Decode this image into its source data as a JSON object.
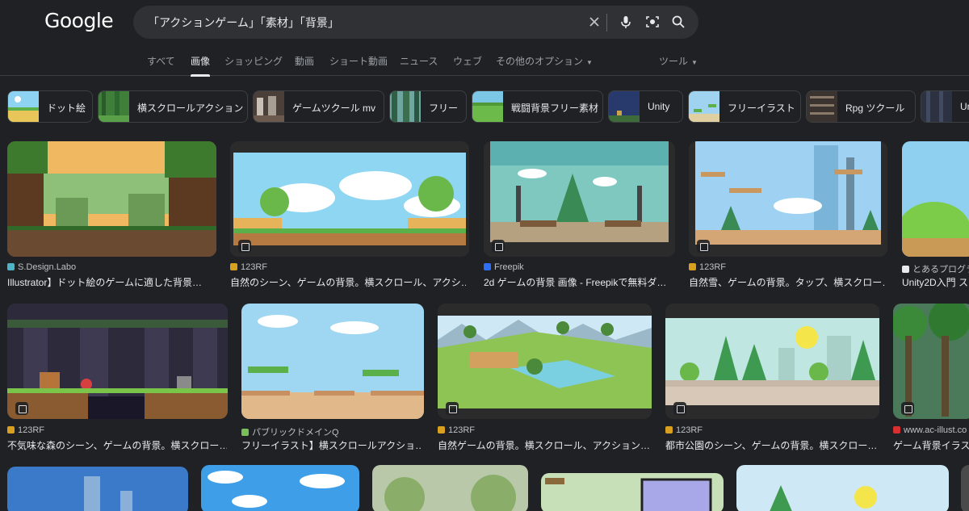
{
  "logo": "Google",
  "search": {
    "query": "「アクションゲーム」「素材」「背景」"
  },
  "icons": {
    "clear": "close-icon",
    "voice": "mic-icon",
    "lens": "camera-lens-icon",
    "search": "search-icon"
  },
  "tabs": [
    {
      "label": "すべて"
    },
    {
      "label": "画像"
    },
    {
      "label": "ショッピング"
    },
    {
      "label": "動画"
    },
    {
      "label": "ショート動画"
    },
    {
      "label": "ニュース"
    },
    {
      "label": "ウェブ"
    },
    {
      "label": "その他のオプション"
    },
    {
      "label": "ツール"
    }
  ],
  "chips": [
    {
      "label": "ドット絵"
    },
    {
      "label": "横スクロールアクション"
    },
    {
      "label": "ゲームツクール mv"
    },
    {
      "label": "フリー"
    },
    {
      "label": "戦闘背景フリー素材"
    },
    {
      "label": "Unity"
    },
    {
      "label": "フリーイラスト"
    },
    {
      "label": "Rpg ツクール"
    },
    {
      "label": "Un"
    }
  ],
  "results": [
    {
      "source": "S.Design.Labo",
      "title": "Illustrator】ドット絵のゲームに適した背景…"
    },
    {
      "source": "123RF",
      "title": "自然のシーン、ゲームの背景。横スクロール、アクシ…"
    },
    {
      "source": "Freepik",
      "title": "2d ゲームの背景 画像 - Freepikで無料ダ…"
    },
    {
      "source": "123RF",
      "title": "自然雪、ゲームの背景。タップ、横スクロー…"
    },
    {
      "source": "とあるプログラ",
      "title": "Unity2D入門 ス"
    },
    {
      "source": "123RF",
      "title": "不気味な森のシーン、ゲームの背景。横スクロー…"
    },
    {
      "source": "パブリックドメインQ",
      "title": "フリーイラスト】横スクロールアクショ…"
    },
    {
      "source": "123RF",
      "title": "自然ゲームの背景。横スクロール、アクション…"
    },
    {
      "source": "123RF",
      "title": "都市公園のシーン、ゲームの背景。横スクロー…"
    },
    {
      "source": "www.ac-illust.co",
      "title": "ゲーム背景イラス"
    }
  ]
}
